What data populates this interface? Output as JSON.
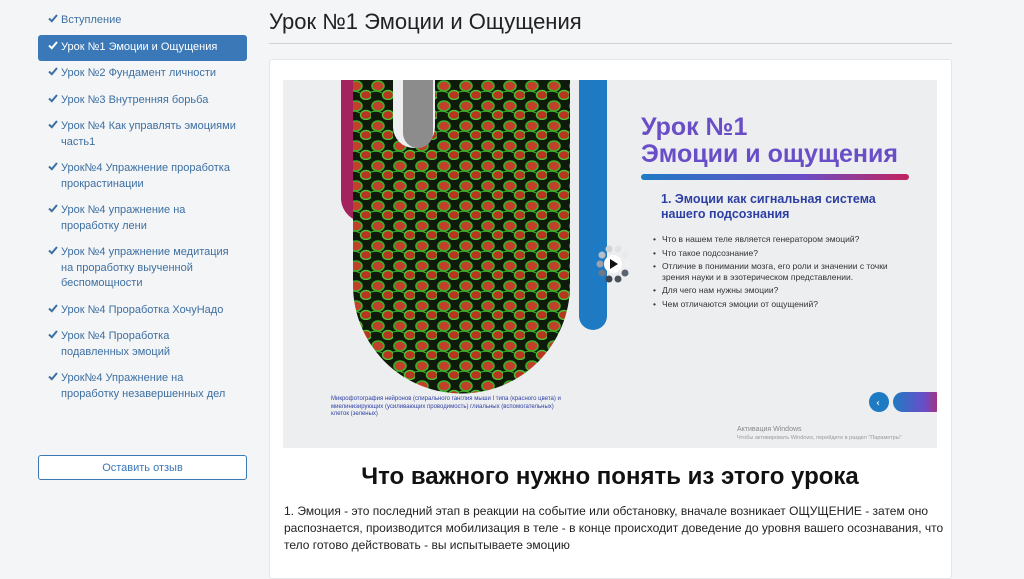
{
  "sidebar": {
    "items": [
      {
        "label": "Вступление",
        "active": false
      },
      {
        "label": "Урок №1 Эмоции и Ощущения",
        "active": true
      },
      {
        "label": "Урок №2 Фундамент личности",
        "active": false
      },
      {
        "label": "Урок №3 Внутренняя борьба",
        "active": false
      },
      {
        "label": "Урок №4 Как управлять эмоциями часть1",
        "active": false
      },
      {
        "label": "Урок№4 Упражнение проработка прокрастинации",
        "active": false
      },
      {
        "label": "Урок №4 упражнение на проработку лени",
        "active": false
      },
      {
        "label": "Урок №4 упражнение медитация на проработку выученной беспомощности",
        "active": false
      },
      {
        "label": "Урок №4 Проработка ХочуНадо",
        "active": false
      },
      {
        "label": "Урок №4 Проработка подавленных эмоций",
        "active": false
      },
      {
        "label": "Урок№4 Упражнение на проработку незавершенных дел",
        "active": false
      }
    ],
    "feedback_label": "Оставить отзыв"
  },
  "main": {
    "title": "Урок №1 Эмоции и Ощущения",
    "video": {
      "slide_title_line1": "Урок №1",
      "slide_title_line2": "Эмоции и ощущения",
      "slide_subtitle": "1. Эмоции как сигнальная система нашего подсознания",
      "bullets": [
        "Что в нашем теле является генератором эмоций?",
        "Что такое подсознание?",
        "Отличие в понимании мозга, его роли и значении с точки зрения науки и в эзотерическом представлении.",
        "Для чего нам нужны эмоции?",
        "Чем отличаются эмоции от ощущений?"
      ],
      "micro_caption": "Микрофотография нейронов (спирального ганглия мыши I типа (красного цвета) и миелинизирующих (усиливающих проводимость) глиальных (вспомогательных) клеток (зеленых)",
      "watermark_line1": "Активация Windows",
      "watermark_line2": "Чтобы активировать Windows, перейдите в раздел \"Параметры\"",
      "colors": {
        "accent_purple": "#6a4ec7",
        "accent_blue": "#1f7ac4",
        "accent_magenta": "#a3235c",
        "micro_red": "#c2402a",
        "micro_green": "#3fae2a"
      }
    },
    "content_heading": "Что важного нужно понять из этого урока",
    "content_text": "1. Эмоция - это последний этап в реакции на событие или обстановку, вначале возникает ОЩУЩЕНИЕ - затем оно распознается, производится мобилизация в теле - в конце происходит доведение до уровня вашего осознавания, что тело готово действовать  - вы испытываете эмоцию"
  }
}
